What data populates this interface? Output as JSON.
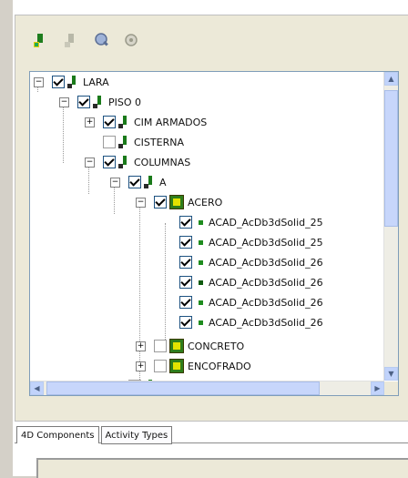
{
  "toolbar": {
    "icons": [
      "add-element-icon",
      "delete-element-icon",
      "zoom-to-element-icon",
      "refresh-icon"
    ]
  },
  "tree": {
    "nodes": [
      {
        "label": "LARA",
        "checked": true
      },
      {
        "label": "PISO 0",
        "checked": true
      },
      {
        "label": "CIM ARMADOS",
        "checked": true
      },
      {
        "label": "CISTERNA",
        "checked": false
      },
      {
        "label": "COLUMNAS",
        "checked": true
      },
      {
        "label": "A",
        "checked": true
      },
      {
        "label": "ACERO",
        "checked": true
      },
      {
        "label": "ACAD_AcDb3dSolid_25",
        "checked": true
      },
      {
        "label": "ACAD_AcDb3dSolid_25",
        "checked": true
      },
      {
        "label": "ACAD_AcDb3dSolid_26",
        "checked": true
      },
      {
        "label": "ACAD_AcDb3dSolid_26",
        "checked": true
      },
      {
        "label": "ACAD_AcDb3dSolid_26",
        "checked": true
      },
      {
        "label": "ACAD_AcDb3dSolid_26",
        "checked": true
      },
      {
        "label": "CONCRETO",
        "checked": false
      },
      {
        "label": "ENCOFRADO",
        "checked": false
      },
      {
        "label": "B",
        "checked": false
      }
    ]
  },
  "tabs": {
    "components": "4D Components",
    "activity_types": "Activity Types"
  },
  "colors": {
    "tree_border": "#7f9db9",
    "scroll_thumb": "#c7d6fb",
    "check_green": "#21a121"
  }
}
